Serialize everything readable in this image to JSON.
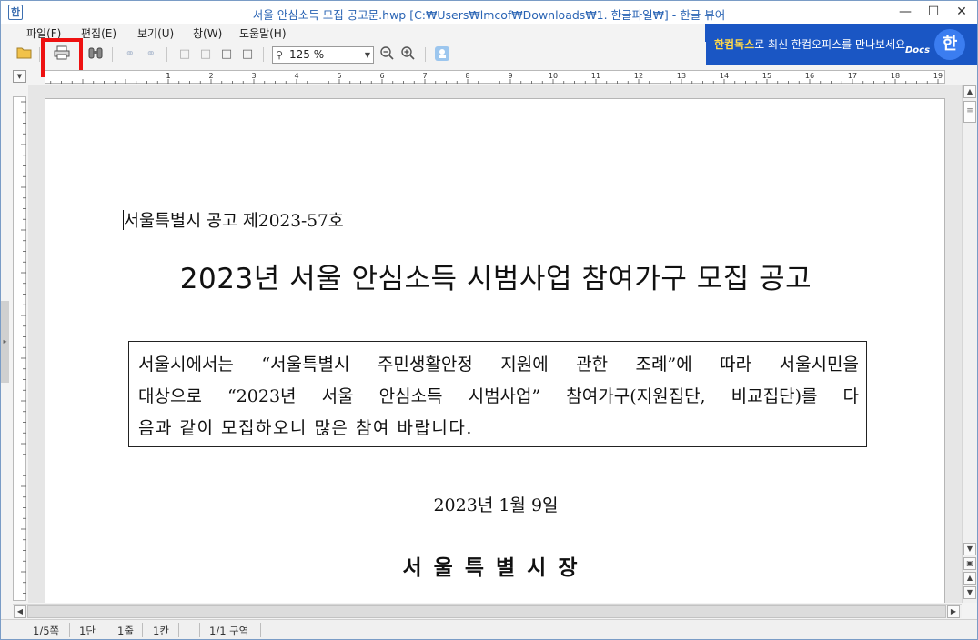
{
  "window": {
    "title": "서울 안심소득 모집 공고문.hwp [C:₩Users₩lmcof₩Downloads₩1. 한글파일₩] - 한글 뷰어",
    "app_icon": "한"
  },
  "menu": {
    "items": [
      {
        "label": "파일(F)"
      },
      {
        "label": "편집(E)"
      },
      {
        "label": "보기(U)"
      },
      {
        "label": "창(W)"
      },
      {
        "label": "도움말(H)"
      }
    ]
  },
  "banner": {
    "highlight": "한컴독스",
    "text": "로 최신 한컴오피스를 만나보세요",
    "docs_label": "Docs",
    "logo_char": "한"
  },
  "toolbar": {
    "zoom_value": "125 %"
  },
  "document": {
    "announce_no": "서울특별시 공고 제2023-57호",
    "title": "2023년 서울 안심소득 시범사업 참여가구 모집 공고",
    "notice_lines": [
      "서울시에서는 “서울특별시 주민생활안정 지원에 관한 조례”에 따라 서울시민을",
      "대상으로 “2023년 서울 안심소득 시범사업” 참여가구(지원집단, 비교집단)를 다",
      "음과 같이 모집하오니 많은 참여 바랍니다."
    ],
    "date": "2023년 1월 9일",
    "signer": "서울특별시장"
  },
  "statusbar": {
    "page": "1/5쪽",
    "column": "1단",
    "line": "1줄",
    "cell": "1칸",
    "section": "1/1 구역"
  },
  "ruler": {
    "labels": [
      "1",
      "1",
      "2",
      "3",
      "4",
      "5",
      "6",
      "7",
      "8",
      "9",
      "10",
      "11",
      "12",
      "13",
      "14",
      "15",
      "16",
      "17",
      "18",
      "19"
    ]
  },
  "colors": {
    "title_blue": "#2a64b4",
    "highlight_red": "#ee1111",
    "banner_blue": "#1a56c4"
  }
}
